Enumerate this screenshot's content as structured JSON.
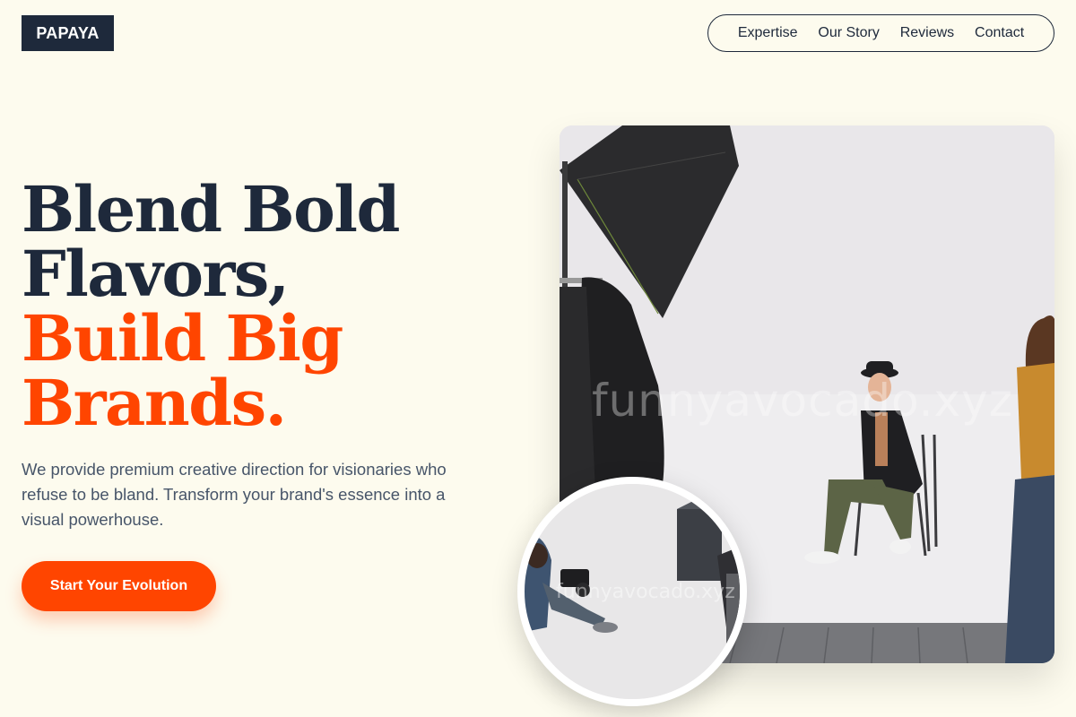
{
  "brand": {
    "logo_text": "PAPAYA"
  },
  "nav": {
    "items": [
      {
        "label": "Expertise"
      },
      {
        "label": "Our Story"
      },
      {
        "label": "Reviews"
      },
      {
        "label": "Contact"
      }
    ]
  },
  "hero": {
    "headline_line1": "Blend Bold",
    "headline_line2": "Flavors,",
    "headline_line3": "Build Big",
    "headline_line4": "Brands.",
    "subtext": "We provide premium creative direction for visionaries who refuse to be bland. Transform your brand's essence into a visual powerhouse.",
    "cta_label": "Start Your Evolution"
  },
  "images": {
    "main_photo_watermark": "funnyavocado.xyz",
    "inset_photo_watermark": "funnyavocado.xyz"
  },
  "colors": {
    "background": "#FDFBEE",
    "primary_dark": "#1E293B",
    "accent": "#FF4500",
    "body_text": "#475569"
  }
}
